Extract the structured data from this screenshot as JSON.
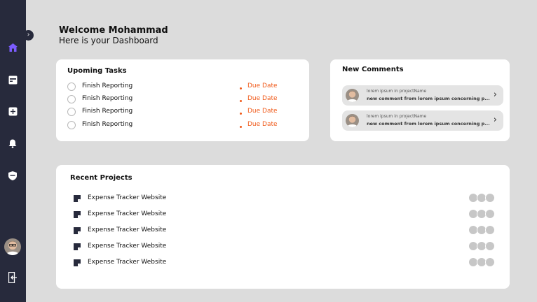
{
  "header": {
    "welcome": "Welcome Mohammad",
    "subtitle": "Here is your Dashboard"
  },
  "sidebar": {
    "icons": [
      "home-icon",
      "inbox-icon",
      "add-square-icon",
      "bell-icon",
      "shield-icon",
      "logout-icon"
    ],
    "accent": "#7b5cff"
  },
  "tasks": {
    "title": "Upoming Tasks",
    "items": [
      {
        "label": "Finish Reporting",
        "due": "Due Date"
      },
      {
        "label": "Finish Reporting",
        "due": "Due Date"
      },
      {
        "label": "Finish Reporting",
        "due": "Due Date"
      },
      {
        "label": "Finish Reporting",
        "due": "Due Date"
      }
    ]
  },
  "comments": {
    "title": "New Comments",
    "items": [
      {
        "meta": "lorem ipsum in projectName",
        "text": "new comment from lorem ipsum concerning p..."
      },
      {
        "meta": "lorem ipsum in projectName",
        "text": "new comment from lorem ipsum concerning p..."
      }
    ]
  },
  "projects": {
    "title": "Recent Projects",
    "items": [
      {
        "label": "Expense Tracker Website"
      },
      {
        "label": "Expense Tracker Website"
      },
      {
        "label": "Expense Tracker Website"
      },
      {
        "label": "Expense Tracker Website"
      },
      {
        "label": "Expense Tracker Website"
      }
    ]
  },
  "colors": {
    "sidebar": "#272a3c",
    "due": "#f05a1a",
    "background": "#dcdcdc"
  }
}
